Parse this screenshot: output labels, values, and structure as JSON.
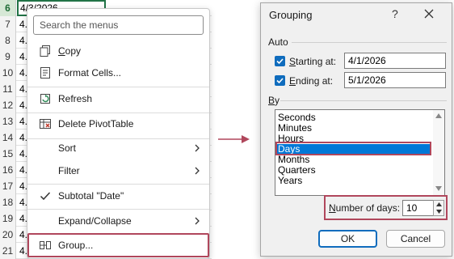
{
  "sheet": {
    "rows": [
      {
        "num": "6",
        "value": "4/3/2026"
      },
      {
        "num": "7",
        "value": "4."
      },
      {
        "num": "8",
        "value": "4."
      },
      {
        "num": "9",
        "value": "4."
      },
      {
        "num": "10",
        "value": "4."
      },
      {
        "num": "11",
        "value": "4."
      },
      {
        "num": "12",
        "value": "4."
      },
      {
        "num": "13",
        "value": "4."
      },
      {
        "num": "14",
        "value": "4."
      },
      {
        "num": "15",
        "value": "4."
      },
      {
        "num": "16",
        "value": "4."
      },
      {
        "num": "17",
        "value": "4."
      },
      {
        "num": "18",
        "value": "4."
      },
      {
        "num": "19",
        "value": "4."
      },
      {
        "num": "20",
        "value": "4."
      },
      {
        "num": "21",
        "value": "4."
      }
    ]
  },
  "context_menu": {
    "search_placeholder": "Search the menus",
    "items": {
      "copy": "Copy",
      "format_cells": "Format Cells...",
      "refresh": "Refresh",
      "delete_pivot": "Delete PivotTable",
      "sort": "Sort",
      "filter": "Filter",
      "subtotal": "Subtotal \"Date\"",
      "expand": "Expand/Collapse",
      "group": "Group..."
    }
  },
  "dialog": {
    "title": "Grouping",
    "help": "?",
    "auto_label": "Auto",
    "starting_label": "Starting at:",
    "starting_value": "4/1/2026",
    "ending_label": "Ending at:",
    "ending_value": "5/1/2026",
    "by_label": "By",
    "by_options": [
      "Seconds",
      "Minutes",
      "Hours",
      "Days",
      "Months",
      "Quarters",
      "Years"
    ],
    "selected_option": "Days",
    "num_days_label": "Number of days:",
    "num_days_value": "10",
    "ok": "OK",
    "cancel": "Cancel"
  },
  "colors": {
    "highlight": "#b0475c",
    "accent": "#0f6cbd",
    "arrow": "#b0475c"
  }
}
